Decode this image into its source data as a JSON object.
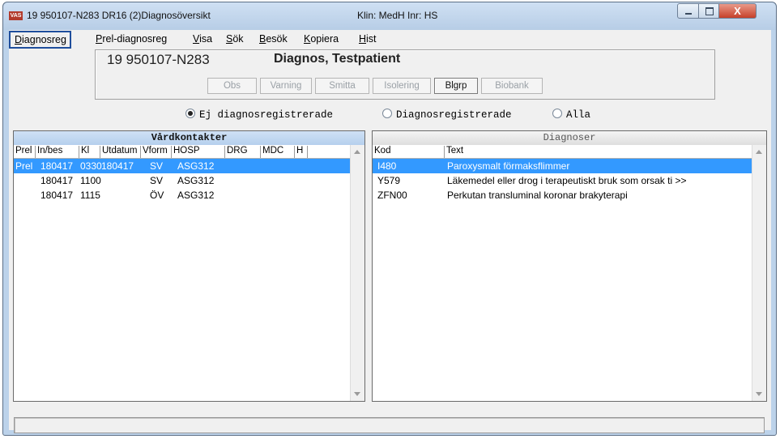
{
  "window": {
    "app_icon_text": "VAS",
    "title": "19 950107-N283   DR16 (2)Diagnosöversikt",
    "klin": "Klin: MedH  Inr: HS",
    "close_glyph": "X"
  },
  "menu": {
    "items": [
      {
        "u": "D",
        "rest": "iagnosreg"
      },
      {
        "u": "P",
        "rest": "rel-diagnosreg"
      },
      {
        "u": "V",
        "rest": "isa"
      },
      {
        "u": "S",
        "rest": "ök"
      },
      {
        "u": "B",
        "rest": "esök"
      },
      {
        "u": "K",
        "rest": "opiera"
      },
      {
        "u": "H",
        "rest": "ist"
      }
    ]
  },
  "patient": {
    "id": "19 950107-N283",
    "name": "Diagnos, Testpatient",
    "flags": [
      "Obs",
      "Varning",
      "Smitta",
      "Isolering",
      "Blgrp",
      "Biobank"
    ]
  },
  "filter": {
    "options": [
      "Ej diagnosregistrerade",
      "Diagnosregistrerade",
      "Alla"
    ],
    "selected": "Ej diagnosregistrerade"
  },
  "vardkontakter": {
    "title": "Vårdkontakter",
    "columns": [
      "Prel",
      "In/bes",
      "Kl",
      "Utdatum",
      "Vform",
      "HOSP",
      "DRG",
      "MDC",
      "H"
    ],
    "rows": [
      {
        "prel": "Prel",
        "inbes": "180417",
        "kl": "0330",
        "utdatum": "180417",
        "vform": "SV",
        "hosp": "ASG312",
        "selected": true
      },
      {
        "prel": "",
        "inbes": "180417",
        "kl": "1100",
        "utdatum": "",
        "vform": "SV",
        "hosp": "ASG312",
        "selected": false
      },
      {
        "prel": "",
        "inbes": "180417",
        "kl": "1115",
        "utdatum": "",
        "vform": "ÖV",
        "hosp": "ASG312",
        "selected": false
      }
    ]
  },
  "diagnoser": {
    "title": "Diagnoser",
    "columns": [
      "Kod",
      "Text"
    ],
    "rows": [
      {
        "kod": "I480",
        "text": "Paroxysmalt förmaksflimmer",
        "selected": true
      },
      {
        "kod": "Y579",
        "text": " Läkemedel eller drog i terapeutiskt bruk som orsak ti >>",
        "selected": false
      },
      {
        "kod": "ZFN00",
        "text": "Perkutan transluminal koronar brakyterapi",
        "selected": false
      }
    ]
  },
  "status": {
    "text": ""
  }
}
